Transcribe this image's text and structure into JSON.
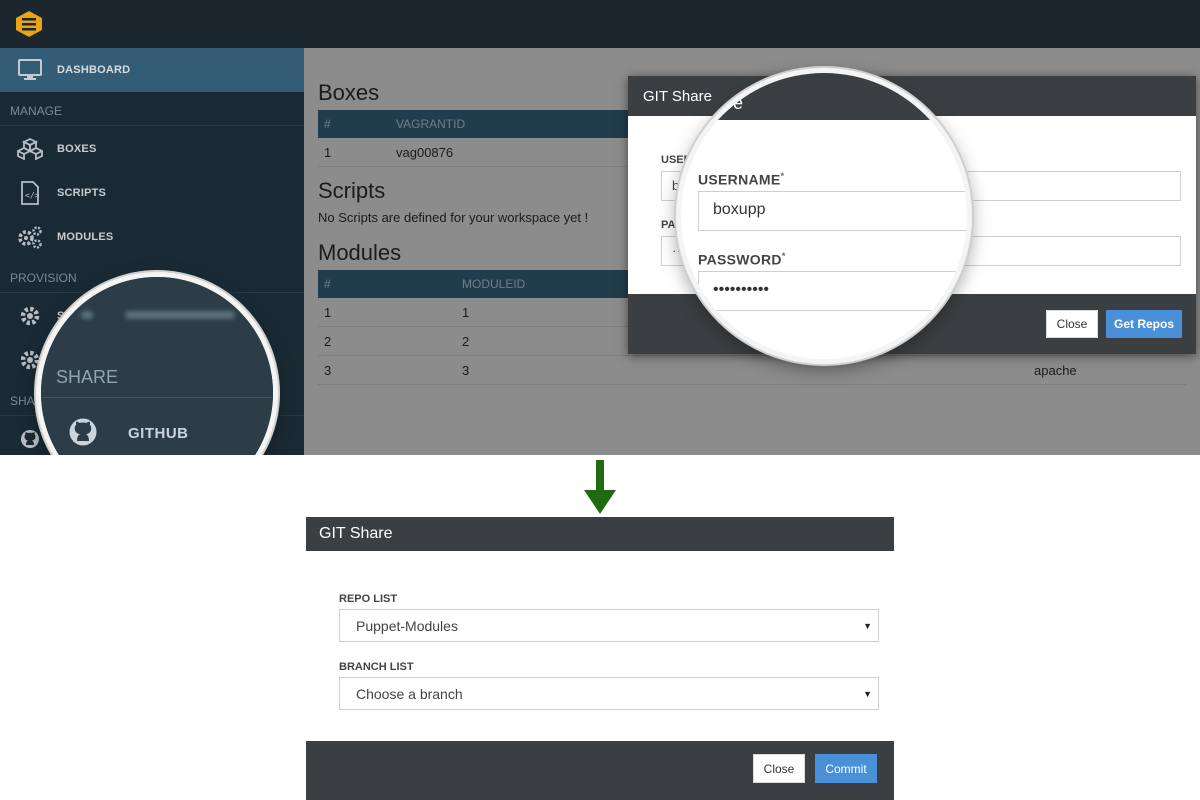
{
  "app": {
    "sidebar": {
      "dashboard": "DASHBOARD",
      "sections": {
        "manage": "MANAGE",
        "provision": "PROVISION",
        "share": "SHAR"
      },
      "items": {
        "boxes": "BOXES",
        "scripts": "SCRIPTS",
        "modules": "MODULES",
        "shell_partial": "SH"
      }
    },
    "main": {
      "boxes_title": "Boxes",
      "boxes_table": {
        "headers": [
          "#",
          "VAGRANTID"
        ],
        "rows": [
          [
            "1",
            "vag00876"
          ]
        ]
      },
      "scripts_title": "Scripts",
      "scripts_note": "No Scripts are defined for your workspace yet !",
      "modules_title": "Modules",
      "modules_table": {
        "headers": [
          "#",
          "MODULEID"
        ],
        "rows": [
          [
            "1",
            "1",
            ""
          ],
          [
            "2",
            "2",
            ""
          ],
          [
            "3",
            "3",
            "apache"
          ]
        ]
      }
    },
    "git_modal": {
      "title": "GIT Share",
      "title_zoom_fragment": "re",
      "username_label": "USERN",
      "username_value": "bo",
      "password_label": "PAS",
      "password_value": "··",
      "close": "Close",
      "get_repos": "Get Repos"
    },
    "zoom_modal": {
      "username_label": "USERNAME",
      "password_label": "PASSWORD",
      "required_mark": "*",
      "username_value": "boxupp",
      "password_value": "••••••••••"
    },
    "zoom_sidebar": {
      "section": "SHARE",
      "item": "GITHUB"
    }
  },
  "share_modal": {
    "title": "GIT Share",
    "repo_label": "REPO LIST",
    "repo_value": "Puppet-Modules",
    "branch_label": "BRANCH LIST",
    "branch_value": "Choose a branch",
    "close": "Close",
    "commit": "Commit"
  },
  "colors": {
    "topbar": "#1c262e",
    "sidebar": "#1f323e",
    "accent_blue": "#3d6e8c",
    "primary_button": "#4a90d9",
    "modal_dark": "#3c3f41",
    "arrow_green": "#1f6b12"
  }
}
